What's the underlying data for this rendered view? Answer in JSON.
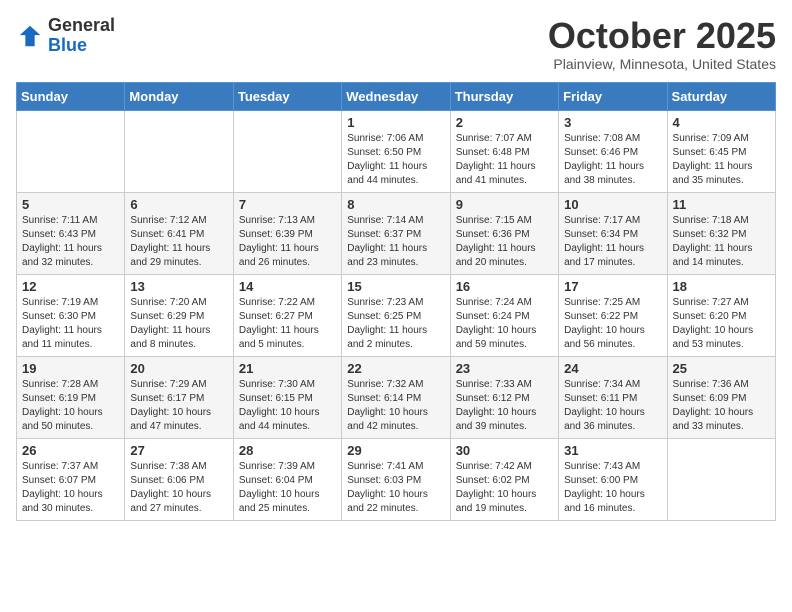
{
  "header": {
    "logo_general": "General",
    "logo_blue": "Blue",
    "title": "October 2025",
    "location": "Plainview, Minnesota, United States"
  },
  "weekdays": [
    "Sunday",
    "Monday",
    "Tuesday",
    "Wednesday",
    "Thursday",
    "Friday",
    "Saturday"
  ],
  "weeks": [
    [
      {
        "day": "",
        "sunrise": "",
        "sunset": "",
        "daylight": ""
      },
      {
        "day": "",
        "sunrise": "",
        "sunset": "",
        "daylight": ""
      },
      {
        "day": "",
        "sunrise": "",
        "sunset": "",
        "daylight": ""
      },
      {
        "day": "1",
        "sunrise": "Sunrise: 7:06 AM",
        "sunset": "Sunset: 6:50 PM",
        "daylight": "Daylight: 11 hours and 44 minutes."
      },
      {
        "day": "2",
        "sunrise": "Sunrise: 7:07 AM",
        "sunset": "Sunset: 6:48 PM",
        "daylight": "Daylight: 11 hours and 41 minutes."
      },
      {
        "day": "3",
        "sunrise": "Sunrise: 7:08 AM",
        "sunset": "Sunset: 6:46 PM",
        "daylight": "Daylight: 11 hours and 38 minutes."
      },
      {
        "day": "4",
        "sunrise": "Sunrise: 7:09 AM",
        "sunset": "Sunset: 6:45 PM",
        "daylight": "Daylight: 11 hours and 35 minutes."
      }
    ],
    [
      {
        "day": "5",
        "sunrise": "Sunrise: 7:11 AM",
        "sunset": "Sunset: 6:43 PM",
        "daylight": "Daylight: 11 hours and 32 minutes."
      },
      {
        "day": "6",
        "sunrise": "Sunrise: 7:12 AM",
        "sunset": "Sunset: 6:41 PM",
        "daylight": "Daylight: 11 hours and 29 minutes."
      },
      {
        "day": "7",
        "sunrise": "Sunrise: 7:13 AM",
        "sunset": "Sunset: 6:39 PM",
        "daylight": "Daylight: 11 hours and 26 minutes."
      },
      {
        "day": "8",
        "sunrise": "Sunrise: 7:14 AM",
        "sunset": "Sunset: 6:37 PM",
        "daylight": "Daylight: 11 hours and 23 minutes."
      },
      {
        "day": "9",
        "sunrise": "Sunrise: 7:15 AM",
        "sunset": "Sunset: 6:36 PM",
        "daylight": "Daylight: 11 hours and 20 minutes."
      },
      {
        "day": "10",
        "sunrise": "Sunrise: 7:17 AM",
        "sunset": "Sunset: 6:34 PM",
        "daylight": "Daylight: 11 hours and 17 minutes."
      },
      {
        "day": "11",
        "sunrise": "Sunrise: 7:18 AM",
        "sunset": "Sunset: 6:32 PM",
        "daylight": "Daylight: 11 hours and 14 minutes."
      }
    ],
    [
      {
        "day": "12",
        "sunrise": "Sunrise: 7:19 AM",
        "sunset": "Sunset: 6:30 PM",
        "daylight": "Daylight: 11 hours and 11 minutes."
      },
      {
        "day": "13",
        "sunrise": "Sunrise: 7:20 AM",
        "sunset": "Sunset: 6:29 PM",
        "daylight": "Daylight: 11 hours and 8 minutes."
      },
      {
        "day": "14",
        "sunrise": "Sunrise: 7:22 AM",
        "sunset": "Sunset: 6:27 PM",
        "daylight": "Daylight: 11 hours and 5 minutes."
      },
      {
        "day": "15",
        "sunrise": "Sunrise: 7:23 AM",
        "sunset": "Sunset: 6:25 PM",
        "daylight": "Daylight: 11 hours and 2 minutes."
      },
      {
        "day": "16",
        "sunrise": "Sunrise: 7:24 AM",
        "sunset": "Sunset: 6:24 PM",
        "daylight": "Daylight: 10 hours and 59 minutes."
      },
      {
        "day": "17",
        "sunrise": "Sunrise: 7:25 AM",
        "sunset": "Sunset: 6:22 PM",
        "daylight": "Daylight: 10 hours and 56 minutes."
      },
      {
        "day": "18",
        "sunrise": "Sunrise: 7:27 AM",
        "sunset": "Sunset: 6:20 PM",
        "daylight": "Daylight: 10 hours and 53 minutes."
      }
    ],
    [
      {
        "day": "19",
        "sunrise": "Sunrise: 7:28 AM",
        "sunset": "Sunset: 6:19 PM",
        "daylight": "Daylight: 10 hours and 50 minutes."
      },
      {
        "day": "20",
        "sunrise": "Sunrise: 7:29 AM",
        "sunset": "Sunset: 6:17 PM",
        "daylight": "Daylight: 10 hours and 47 minutes."
      },
      {
        "day": "21",
        "sunrise": "Sunrise: 7:30 AM",
        "sunset": "Sunset: 6:15 PM",
        "daylight": "Daylight: 10 hours and 44 minutes."
      },
      {
        "day": "22",
        "sunrise": "Sunrise: 7:32 AM",
        "sunset": "Sunset: 6:14 PM",
        "daylight": "Daylight: 10 hours and 42 minutes."
      },
      {
        "day": "23",
        "sunrise": "Sunrise: 7:33 AM",
        "sunset": "Sunset: 6:12 PM",
        "daylight": "Daylight: 10 hours and 39 minutes."
      },
      {
        "day": "24",
        "sunrise": "Sunrise: 7:34 AM",
        "sunset": "Sunset: 6:11 PM",
        "daylight": "Daylight: 10 hours and 36 minutes."
      },
      {
        "day": "25",
        "sunrise": "Sunrise: 7:36 AM",
        "sunset": "Sunset: 6:09 PM",
        "daylight": "Daylight: 10 hours and 33 minutes."
      }
    ],
    [
      {
        "day": "26",
        "sunrise": "Sunrise: 7:37 AM",
        "sunset": "Sunset: 6:07 PM",
        "daylight": "Daylight: 10 hours and 30 minutes."
      },
      {
        "day": "27",
        "sunrise": "Sunrise: 7:38 AM",
        "sunset": "Sunset: 6:06 PM",
        "daylight": "Daylight: 10 hours and 27 minutes."
      },
      {
        "day": "28",
        "sunrise": "Sunrise: 7:39 AM",
        "sunset": "Sunset: 6:04 PM",
        "daylight": "Daylight: 10 hours and 25 minutes."
      },
      {
        "day": "29",
        "sunrise": "Sunrise: 7:41 AM",
        "sunset": "Sunset: 6:03 PM",
        "daylight": "Daylight: 10 hours and 22 minutes."
      },
      {
        "day": "30",
        "sunrise": "Sunrise: 7:42 AM",
        "sunset": "Sunset: 6:02 PM",
        "daylight": "Daylight: 10 hours and 19 minutes."
      },
      {
        "day": "31",
        "sunrise": "Sunrise: 7:43 AM",
        "sunset": "Sunset: 6:00 PM",
        "daylight": "Daylight: 10 hours and 16 minutes."
      },
      {
        "day": "",
        "sunrise": "",
        "sunset": "",
        "daylight": ""
      }
    ]
  ]
}
